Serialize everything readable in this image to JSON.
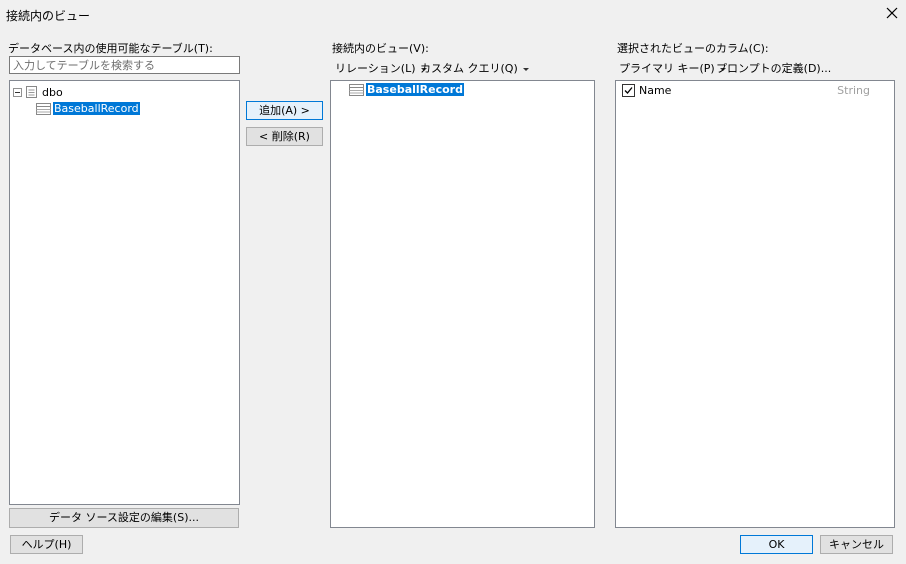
{
  "window": {
    "title": "接続内のビュー"
  },
  "icons": {
    "close": "close-icon",
    "db": "database-icon",
    "table": "table-icon"
  },
  "colors": {
    "selection": "#0078d7",
    "background": "#f0f0f0"
  },
  "available": {
    "label": "データベース内の使用可能なテーブル(T):",
    "search_placeholder": "入力してテーブルを検索する",
    "root": "dbo",
    "table": "BaseballRecord"
  },
  "buttons": {
    "add": "追加(A) >",
    "remove": "< 削除(R)",
    "edit_source": "データ ソース設定の編集(S)...",
    "help": "ヘルプ(H)",
    "ok": "OK",
    "cancel": "キャンセル"
  },
  "views": {
    "label": "接続内のビュー(V):",
    "relation_menu": "リレーション(L)",
    "custom_query_menu": "カスタム クエリ(Q)",
    "items": [
      "BaseballRecord"
    ]
  },
  "columns": {
    "label": "選択されたビューのカラム(C):",
    "primary_key_menu": "プライマリ キー(P)",
    "prompt_link": "プロンプトの定義(D)...",
    "items": [
      {
        "name": "Name",
        "type": "String",
        "checked": true
      }
    ]
  }
}
